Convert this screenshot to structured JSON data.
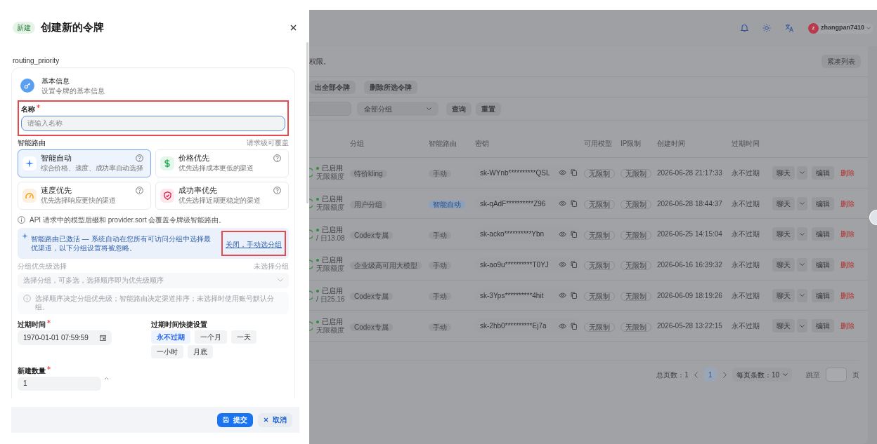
{
  "drawer": {
    "badge": "新建",
    "title": "创建新的令牌",
    "subtitle": "routing_priority",
    "section": {
      "title": "基本信息",
      "subtitle": "设置令牌的基本信息"
    },
    "name_field": {
      "label": "名称",
      "required": true,
      "placeholder": "请输入名称"
    },
    "routing": {
      "label": "智能路由",
      "hint": "请求级可覆盖",
      "options": [
        {
          "kind": "auto",
          "title": "智能自动",
          "desc": "综合价格、速度、成功率自动选择",
          "selected": true
        },
        {
          "kind": "price",
          "title": "价格优先",
          "desc": "优先选择成本更低的渠道",
          "selected": false
        },
        {
          "kind": "speed",
          "title": "速度优先",
          "desc": "优先选择响应更快的渠道",
          "selected": false
        },
        {
          "kind": "success",
          "title": "成功率优先",
          "desc": "优先选择近期更稳定的渠道",
          "selected": false
        }
      ]
    },
    "routing_note": "API 请求中的模型后缀和 provider.sort 会覆盖令牌级智能路由。",
    "routing_alert": {
      "text": "智能路由已激活 — 系统自动在您所有可访问分组中选择最优渠道，以下分组设置将被忽略。",
      "link": "关闭，手动选分组"
    },
    "group_priority": {
      "label": "分组优先级选择",
      "hint": "未选择分组",
      "placeholder": "选择分组，可多选，选择顺序即为优先级顺序",
      "note": "选择顺序决定分组优先级；智能路由决定渠道排序；未选择时使用账号默认分组。",
      "disabled": true
    },
    "expiry": {
      "label": "过期时间",
      "required": true,
      "value": "1970-01-01 07:59:59"
    },
    "expiry_presets": {
      "label": "过期时间快捷设置",
      "options": [
        {
          "label": "永不过期",
          "selected": true
        },
        {
          "label": "一个月",
          "selected": false
        },
        {
          "label": "一天",
          "selected": false
        },
        {
          "label": "一小时",
          "selected": false
        },
        {
          "label": "月底",
          "selected": false
        }
      ]
    },
    "count": {
      "label": "新建数量",
      "required": true,
      "value": "1"
    },
    "footer": {
      "submit": "提交",
      "cancel": "取消"
    }
  },
  "page": {
    "user": {
      "initial": "z",
      "name": "zhangpan7410"
    },
    "description": "权限。",
    "compact_button": "紧凑列表",
    "actions": [
      "出全部令牌",
      "删除所选令牌"
    ],
    "filter": {
      "group": "全部分组",
      "query": "查询",
      "reset": "重置"
    },
    "table": {
      "columns": [
        "分组",
        "智能路由",
        "密钥",
        "可用模型",
        "IP限制",
        "创建时间",
        "过期时间"
      ],
      "rows": [
        {
          "status": "已启用",
          "quota": "无限额度",
          "group": "特价kling",
          "routing": "手动",
          "routing_auto": false,
          "key": "sk-WYnb**********QSL",
          "models": "无限制",
          "ip": "无限制",
          "created": "2026-06-28 21:17:33",
          "expires": "永不过期",
          "chat": "聊天",
          "edit": "编辑",
          "delete": "删除"
        },
        {
          "status": "已启用",
          "quota": "无限额度",
          "group": "用户分组",
          "routing": "智能自动",
          "routing_auto": true,
          "key": "sk-qAdF**********Z96",
          "models": "无限制",
          "ip": "无限制",
          "created": "2026-06-28 18:44:37",
          "expires": "永不过期",
          "chat": "聊天",
          "edit": "编辑",
          "delete": "删除"
        },
        {
          "status": "已启用",
          "quota": "/ 日13.08",
          "group": "Codex专属",
          "routing": "手动",
          "routing_auto": false,
          "key": "sk-acko**********Ybn",
          "models": "无限制",
          "ip": "无限制",
          "created": "2026-06-25 14:15:04",
          "expires": "永不过期",
          "chat": "聊天",
          "edit": "编辑",
          "delete": "删除"
        },
        {
          "status": "已启用",
          "quota": "无限额度",
          "group": "企业级高可用大模型",
          "routing": "手动",
          "routing_auto": false,
          "key": "sk-ao9u**********T0YJ",
          "models": "无限制",
          "ip": "无限制",
          "created": "2026-06-16 16:39:32",
          "expires": "永不过期",
          "chat": "聊天",
          "edit": "编辑",
          "delete": "删除"
        },
        {
          "status": "已启用",
          "quota": "/ 日25.16",
          "group": "Codex专属",
          "routing": "手动",
          "routing_auto": false,
          "key": "sk-3Yps**********4hit",
          "models": "无限制",
          "ip": "无限制",
          "created": "2026-06-09 18:19:26",
          "expires": "永不过期",
          "chat": "聊天",
          "edit": "编辑",
          "delete": "删除"
        },
        {
          "status": "已启用",
          "quota": "无限额度",
          "group": "Codex专属",
          "routing": "手动",
          "routing_auto": false,
          "key": "sk-2hb0**********Ej7a",
          "models": "无限制",
          "ip": "无限制",
          "created": "2026-05-28 13:22:15",
          "expires": "永不过期",
          "chat": "聊天",
          "edit": "编辑",
          "delete": "删除"
        }
      ]
    },
    "pagination": {
      "total": "总页数：1",
      "page": "1",
      "page_size": "每页条数：10",
      "jump": "跳至",
      "page_suffix": "页"
    }
  }
}
